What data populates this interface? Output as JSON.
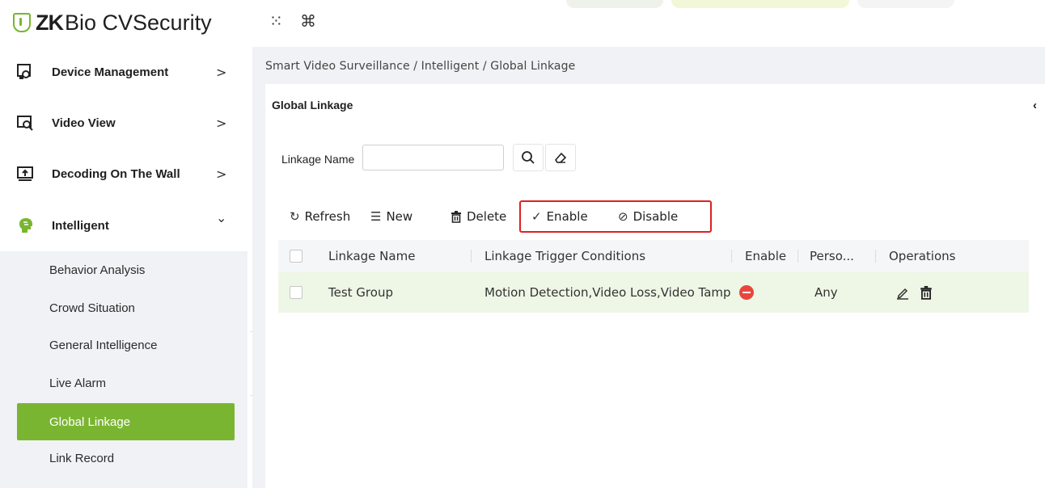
{
  "app": {
    "logo_zk": "ZK",
    "logo_rest": "Bio CVSecurity",
    "menu_icon": "grid-icon",
    "command_icon": "command-icon"
  },
  "sidebar": {
    "items": [
      {
        "label": "Device Management",
        "icon": "device-icon",
        "chevron": ">"
      },
      {
        "label": "Video View",
        "icon": "video-view-icon",
        "chevron": ">"
      },
      {
        "label": "Decoding On The Wall",
        "icon": "wall-decoding-icon",
        "chevron": ">"
      },
      {
        "label": "Intelligent",
        "icon": "intelligent-icon",
        "chevron": "⌄"
      }
    ],
    "subitems": [
      {
        "label": "Behavior Analysis"
      },
      {
        "label": "Crowd Situation"
      },
      {
        "label": "General Intelligence"
      },
      {
        "label": "Live Alarm"
      },
      {
        "label": "Global Linkage",
        "active": true
      },
      {
        "label": "Link Record"
      }
    ],
    "collapse_glyph": "«"
  },
  "main": {
    "breadcrumb": "Smart Video Surveillance / Intelligent / Global Linkage",
    "panel_title": "Global Linkage",
    "panel_collapse_glyph": "‹",
    "search": {
      "label": "Linkage Name",
      "value": "",
      "placeholder": ""
    },
    "toolbar": {
      "refresh": "Refresh",
      "new": "New",
      "delete": "Delete",
      "enable": "Enable",
      "disable": "Disable"
    },
    "table": {
      "columns": [
        "Linkage Name",
        "Linkage Trigger Conditions",
        "Enable",
        "Perso...",
        "Operations"
      ],
      "rows": [
        {
          "name": "Test Group",
          "conditions": "Motion Detection,Video Loss,Video Tampering",
          "enabled": false,
          "person": "Any"
        }
      ]
    }
  },
  "colors": {
    "brand_green": "#7ab531",
    "highlight_red": "#e02020",
    "disabled_red": "#e8463d",
    "row_highlight": "#eef7e6"
  }
}
